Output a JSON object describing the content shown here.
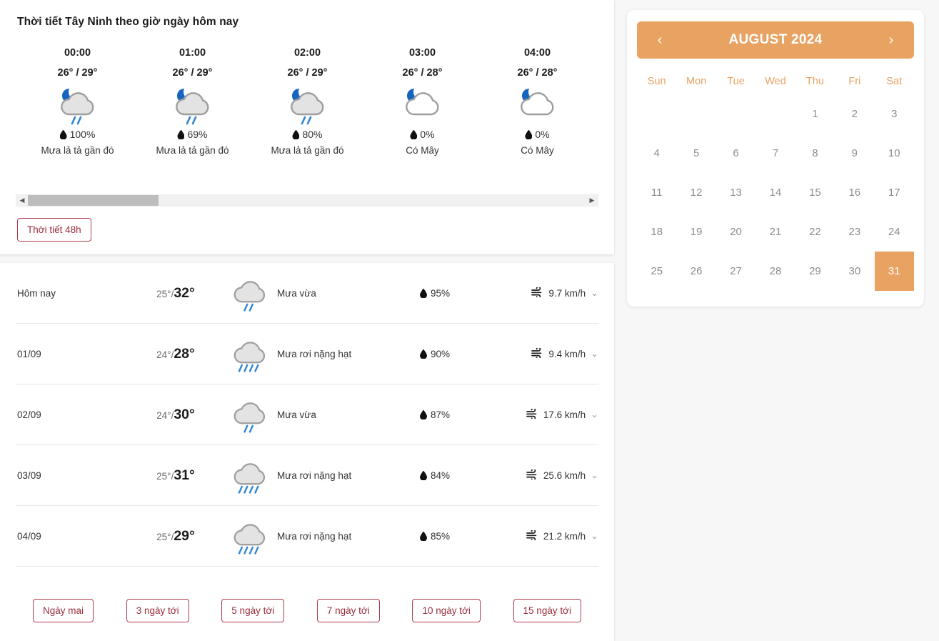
{
  "hourly": {
    "title": "Thời tiết Tây Ninh theo giờ ngày hôm nay",
    "items": [
      {
        "time": "00:00",
        "temp": "26° / 29°",
        "pop": "100%",
        "desc": "Mưa lả tả gần đó",
        "icon": "moon-cloud-rain-light-icon"
      },
      {
        "time": "01:00",
        "temp": "26° / 29°",
        "pop": "69%",
        "desc": "Mưa lả tả gần đó",
        "icon": "moon-cloud-rain-light-icon"
      },
      {
        "time": "02:00",
        "temp": "26° / 29°",
        "pop": "80%",
        "desc": "Mưa lả tả gần đó",
        "icon": "moon-cloud-rain-light-icon"
      },
      {
        "time": "03:00",
        "temp": "26° / 28°",
        "pop": "0%",
        "desc": "Có Mây",
        "icon": "moon-cloud-icon"
      },
      {
        "time": "04:00",
        "temp": "26° / 28°",
        "pop": "0%",
        "desc": "Có Mây",
        "icon": "moon-cloud-icon"
      }
    ],
    "scroll_left_arrow": "◀",
    "scroll_right_arrow": "▶",
    "button_48h": "Thời tiết 48h"
  },
  "daily": {
    "rows": [
      {
        "date": "Hôm nay",
        "lo": "25°/",
        "hi": "32°",
        "cond": "Mưa vừa",
        "icon": "cloud-rain-moderate-icon",
        "hum": "95%",
        "wind": "9.7 km/h"
      },
      {
        "date": "01/09",
        "lo": "24°/",
        "hi": "28°",
        "cond": "Mưa rơi nặng hạt",
        "icon": "cloud-rain-heavy-icon",
        "hum": "90%",
        "wind": "9.4 km/h"
      },
      {
        "date": "02/09",
        "lo": "24°/",
        "hi": "30°",
        "cond": "Mưa vừa",
        "icon": "cloud-rain-moderate-icon",
        "hum": "87%",
        "wind": "17.6 km/h"
      },
      {
        "date": "03/09",
        "lo": "25°/",
        "hi": "31°",
        "cond": "Mưa rơi nặng hạt",
        "icon": "cloud-rain-heavy-icon",
        "hum": "84%",
        "wind": "25.6 km/h"
      },
      {
        "date": "04/09",
        "lo": "25°/",
        "hi": "29°",
        "cond": "Mưa rơi nặng hạt",
        "icon": "cloud-rain-heavy-icon",
        "hum": "85%",
        "wind": "21.2 km/h"
      }
    ],
    "range_buttons": [
      "Ngày mai",
      "3 ngày tới",
      "5 ngày tới",
      "7 ngày tới",
      "10 ngày tới",
      "15 ngày tới"
    ]
  },
  "calendar": {
    "title": "AUGUST 2024",
    "prev": "‹",
    "next": "›",
    "dow": [
      "Sun",
      "Mon",
      "Tue",
      "Wed",
      "Thu",
      "Fri",
      "Sat"
    ],
    "lead_blanks": 4,
    "days": [
      1,
      2,
      3,
      4,
      5,
      6,
      7,
      8,
      9,
      10,
      11,
      12,
      13,
      14,
      15,
      16,
      17,
      18,
      19,
      20,
      21,
      22,
      23,
      24,
      25,
      26,
      27,
      28,
      29,
      30,
      31
    ],
    "selected_day": 31,
    "accent_color": "#e8a262"
  }
}
